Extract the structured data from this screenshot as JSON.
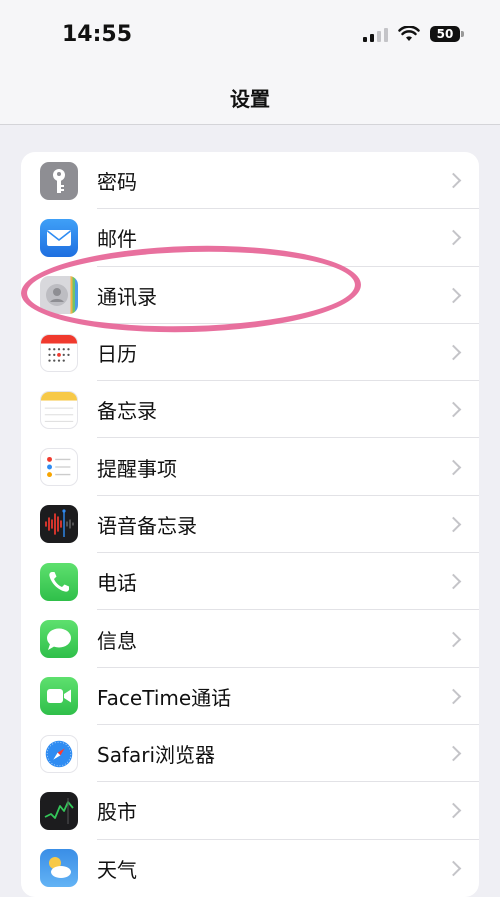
{
  "status_bar": {
    "time": "14:55",
    "battery": "50"
  },
  "nav": {
    "title": "设置"
  },
  "settings": [
    {
      "label": "密码",
      "icon": "key-icon",
      "color": "#8e8e93"
    },
    {
      "label": "邮件",
      "icon": "envelope-icon",
      "color": "#2f8cf2"
    },
    {
      "label": "通讯录",
      "icon": "contacts-icon",
      "color": "#d0d0d4"
    },
    {
      "label": "日历",
      "icon": "calendar-icon",
      "color": "#ffffff"
    },
    {
      "label": "备忘录",
      "icon": "notes-icon",
      "color": "#ffffff"
    },
    {
      "label": "提醒事项",
      "icon": "reminders-icon",
      "color": "#ffffff"
    },
    {
      "label": "语音备忘录",
      "icon": "waveform-icon",
      "color": "#1c1c1e"
    },
    {
      "label": "电话",
      "icon": "phone-icon",
      "color": "#34c759"
    },
    {
      "label": "信息",
      "icon": "message-icon",
      "color": "#34c759"
    },
    {
      "label": "FaceTime通话",
      "icon": "video-camera-icon",
      "color": "#34c759"
    },
    {
      "label": "Safari浏览器",
      "icon": "compass-icon",
      "color": "#ffffff"
    },
    {
      "label": "股市",
      "icon": "stocks-icon",
      "color": "#1c1c1e"
    },
    {
      "label": "天气",
      "icon": "weather-icon",
      "color": "#3a8ee6"
    }
  ],
  "annotation": {
    "highlight_color": "#e8709e"
  }
}
